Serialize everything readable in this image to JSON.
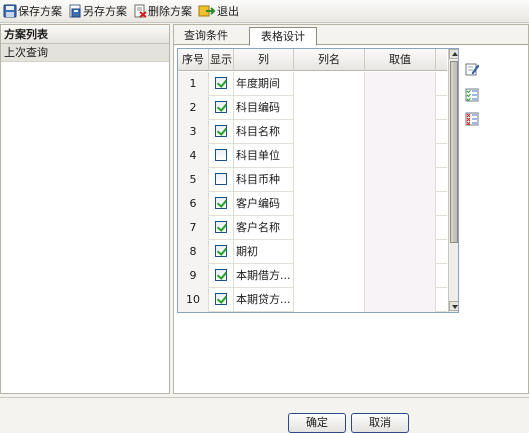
{
  "toolbar": {
    "save": "保存方案",
    "save_as": "另存方案",
    "delete": "删除方案",
    "exit": "退出"
  },
  "left_panel": {
    "title": "方案列表",
    "items": [
      "上次查询"
    ]
  },
  "tabs": [
    "查询条件",
    "表格设计"
  ],
  "grid": {
    "headers": [
      "序号",
      "显示",
      "列",
      "列名",
      "取值"
    ],
    "rows": [
      {
        "seq": "1",
        "checked": true,
        "col": "年度期间"
      },
      {
        "seq": "2",
        "checked": true,
        "col": "科目编码"
      },
      {
        "seq": "3",
        "checked": true,
        "col": "科目名称"
      },
      {
        "seq": "4",
        "checked": false,
        "col": "科目单位"
      },
      {
        "seq": "5",
        "checked": false,
        "col": "科目币种"
      },
      {
        "seq": "6",
        "checked": true,
        "col": "客户编码"
      },
      {
        "seq": "7",
        "checked": true,
        "col": "客户名称"
      },
      {
        "seq": "8",
        "checked": true,
        "col": "期初"
      },
      {
        "seq": "9",
        "checked": true,
        "col": "本期借方..."
      },
      {
        "seq": "10",
        "checked": true,
        "col": "本期贷方..."
      }
    ]
  },
  "footer": {
    "ok": "确定",
    "cancel": "取消"
  }
}
